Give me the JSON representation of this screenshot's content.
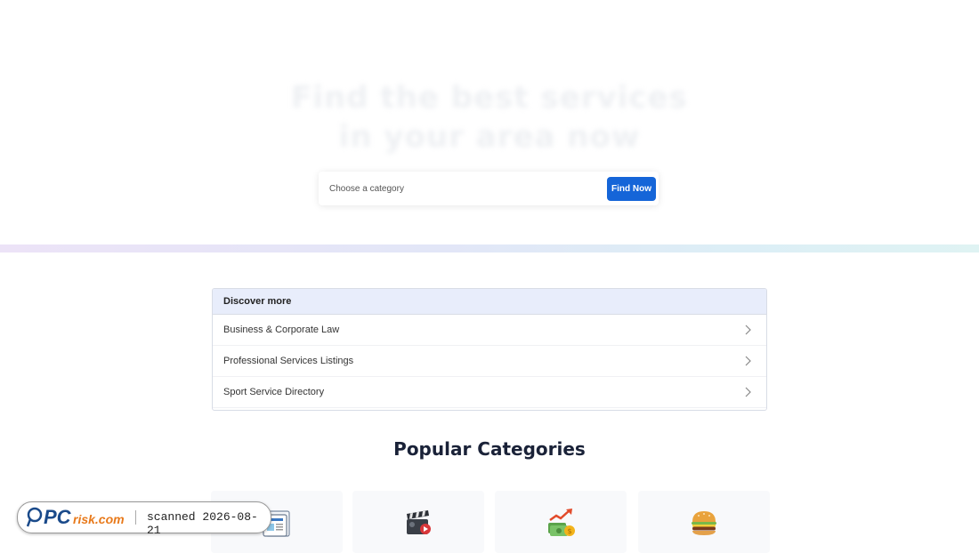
{
  "hero": {
    "title_line1": "Find the best services",
    "title_line2": "in your area now"
  },
  "search": {
    "placeholder": "Choose a category",
    "button_label": "Find Now"
  },
  "discover": {
    "header": "Discover more",
    "items": [
      {
        "label": "Business & Corporate Law"
      },
      {
        "label": "Professional Services Listings"
      },
      {
        "label": "Sport Service Directory"
      }
    ]
  },
  "popular": {
    "title": "Popular Categories",
    "cards": [
      {
        "icon": "newspaper-icon"
      },
      {
        "icon": "movie-clapper-icon"
      },
      {
        "icon": "money-growth-icon"
      },
      {
        "icon": "burger-icon"
      }
    ]
  },
  "watermark": {
    "brand": "PCrisk.com",
    "brand_pc": "PC",
    "brand_rest": "risk.com",
    "scan_text": "scanned 2026-08-21"
  },
  "colors": {
    "accent": "#1565d8",
    "brand_blue": "#1a4a8a",
    "brand_orange": "#e8791a"
  }
}
